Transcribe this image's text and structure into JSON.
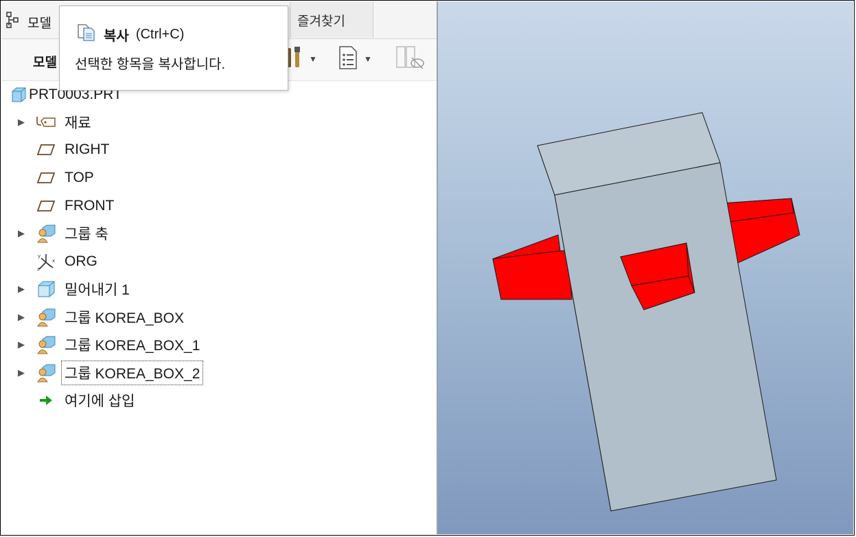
{
  "tabs": {
    "model_tab": "모델",
    "favorites_tab": "즐겨찾기"
  },
  "toolbar": {
    "label": "모델",
    "icons": [
      "settings-icon",
      "show-list-icon",
      "hide-icon"
    ]
  },
  "tooltip": {
    "title": "복사",
    "shortcut": "(Ctrl+C)",
    "description": "선택한 항목을 복사합니다."
  },
  "tree": {
    "root": "PRT0003.PRT",
    "items": [
      {
        "label": "재료",
        "icon": "material-tag-icon",
        "expandable": true
      },
      {
        "label": "RIGHT",
        "icon": "datum-plane-icon",
        "expandable": false
      },
      {
        "label": "TOP",
        "icon": "datum-plane-icon",
        "expandable": false
      },
      {
        "label": "FRONT",
        "icon": "datum-plane-icon",
        "expandable": false
      },
      {
        "label": "그룹 축",
        "icon": "group-icon",
        "expandable": true
      },
      {
        "label": "ORG",
        "icon": "coordinate-system-icon",
        "expandable": false
      },
      {
        "label": "밀어내기 1",
        "icon": "extrude-icon",
        "expandable": true
      },
      {
        "label": "그룹 KOREA_BOX",
        "icon": "group-icon",
        "expandable": true
      },
      {
        "label": "그룹 KOREA_BOX_1",
        "icon": "group-icon",
        "expandable": true
      },
      {
        "label": "그룹 KOREA_BOX_2",
        "icon": "group-icon",
        "expandable": true
      },
      {
        "label": "여기에 삽입",
        "icon": "insert-here-arrow-icon",
        "expandable": false
      }
    ]
  },
  "colors": {
    "feature_red": "#ff0000",
    "body_gray": "#b7c4cf",
    "insert_arrow_green": "#1a9c1a",
    "viewport_top": "#cad9ea",
    "viewport_bottom": "#7f98bd"
  }
}
